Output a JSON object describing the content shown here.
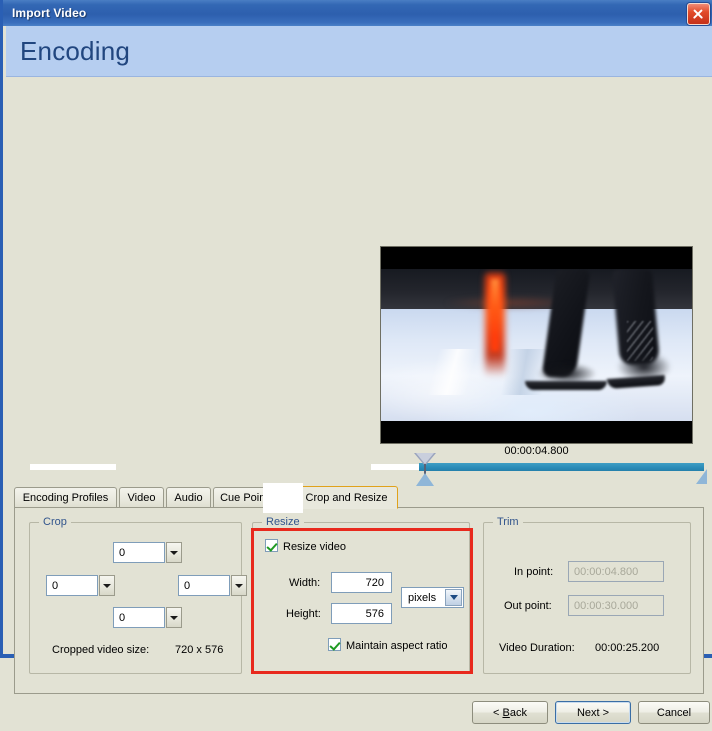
{
  "window": {
    "title": "Import Video",
    "close_label": "Close",
    "header": "Encoding"
  },
  "preview": {
    "timestamp": "00:00:04.800"
  },
  "tabs": [
    {
      "label": "Encoding Profiles",
      "active": false
    },
    {
      "label": "Video",
      "active": false
    },
    {
      "label": "Audio",
      "active": false
    },
    {
      "label": "Cue Points",
      "active": false
    },
    {
      "label": "Crop and Resize",
      "active": true
    }
  ],
  "crop": {
    "legend": "Crop",
    "top_value": "0",
    "left_value": "0",
    "right_value": "0",
    "bottom_value": "0",
    "size_label": "Cropped video size:",
    "size_value": "720 x 576"
  },
  "resize": {
    "legend": "Resize",
    "resize_video_label": "Resize video",
    "width_label": "Width:",
    "width_value": "720",
    "height_label": "Height:",
    "height_value": "576",
    "unit_value": "pixels",
    "maintain_label": "Maintain aspect ratio"
  },
  "trim": {
    "legend": "Trim",
    "in_label": "In point:",
    "in_value": "00:00:04.800",
    "out_label": "Out point:",
    "out_value": "00:00:30.000",
    "duration_label": "Video Duration:",
    "duration_value": "00:00:25.200"
  },
  "buttons": {
    "back": "< Back",
    "back_accel": "B",
    "next": "Next >",
    "cancel": "Cancel"
  },
  "colors": {
    "titlebar": "#2d5fae",
    "banner": "#b6cef0",
    "banner_text": "#21467f",
    "dialog_bg": "#e2e2d4",
    "highlight_red": "#e8291d",
    "active_tab_border": "#e0a21b",
    "scrubber": "#2b8cb8",
    "group_legend": "#31548c"
  }
}
